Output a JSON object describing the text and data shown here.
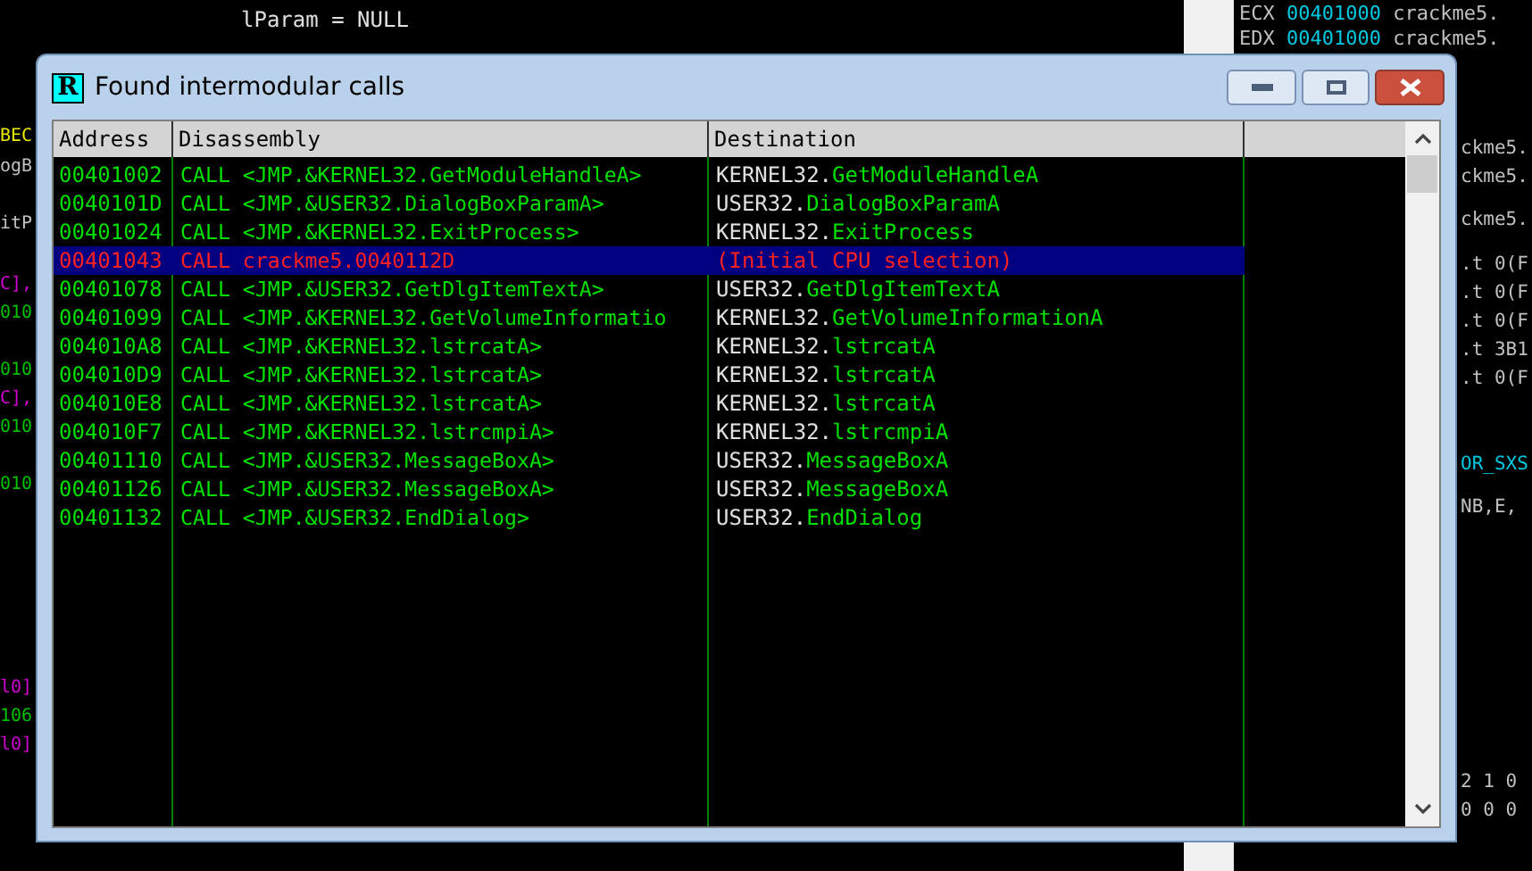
{
  "background": {
    "top_text": "lParam = NULL",
    "left_fragments": [
      {
        "text": "BEC",
        "color": "#e8e800"
      },
      {
        "text": "ogB",
        "color": "#c0c0c0"
      },
      {
        "text": "itP",
        "color": "#c0c0c0"
      },
      {
        "text": "C],",
        "color": "#d000d0"
      },
      {
        "text": "010",
        "color": "#00c000"
      },
      {
        "text": "010",
        "color": "#00c000"
      },
      {
        "text": "C],",
        "color": "#d000d0"
      },
      {
        "text": "010",
        "color": "#00c000"
      },
      {
        "text": "010",
        "color": "#00c000"
      },
      {
        "text": "l0]",
        "color": "#d000d0"
      },
      {
        "text": "106",
        "color": "#00c000"
      },
      {
        "text": "l0]",
        "color": "#d000d0"
      }
    ],
    "registers": [
      {
        "name": "ECX",
        "value": "00401000",
        "comment": "crackme5."
      },
      {
        "name": "EDX",
        "value": "00401000",
        "comment": "crackme5."
      }
    ],
    "right_fragments": [
      {
        "text": "ckme5.",
        "color": "#c0c0c0"
      },
      {
        "text": "ckme5.",
        "color": "#c0c0c0"
      },
      {
        "text": "ckme5.",
        "color": "#c0c0c0"
      },
      {
        "text": ".t 0(F",
        "color": "#c0c0c0"
      },
      {
        "text": ".t 0(F",
        "color": "#c0c0c0"
      },
      {
        "text": ".t 0(F",
        "color": "#c0c0c0"
      },
      {
        "text": ".t 3B1",
        "color": "#c0c0c0"
      },
      {
        "text": ".t 0(F",
        "color": "#c0c0c0"
      },
      {
        "text": "OR_SXS",
        "color": "#00c8e0"
      },
      {
        "text": "NB,E,",
        "color": "#c0c0c0"
      },
      {
        "text": "2 1 0",
        "color": "#c0c0c0"
      },
      {
        "text": "0 0 0",
        "color": "#c0c0c0"
      }
    ]
  },
  "window": {
    "icon_letter": "R",
    "title": "Found intermodular calls"
  },
  "table": {
    "columns": [
      "Address",
      "Disassembly",
      "Destination"
    ],
    "rows": [
      {
        "address": "00401002",
        "disassembly": "CALL <JMP.&KERNEL32.GetModuleHandleA>",
        "destination": {
          "module": "KERNEL32.",
          "function": "GetModuleHandleA"
        },
        "selected": false
      },
      {
        "address": "0040101D",
        "disassembly": "CALL <JMP.&USER32.DialogBoxParamA>",
        "destination": {
          "module": "USER32.",
          "function": "DialogBoxParamA"
        },
        "selected": false
      },
      {
        "address": "00401024",
        "disassembly": "CALL <JMP.&KERNEL32.ExitProcess>",
        "destination": {
          "module": "KERNEL32.",
          "function": "ExitProcess"
        },
        "selected": false
      },
      {
        "address": "00401043",
        "disassembly": "CALL crackme5.0040112D",
        "destination": {
          "function": "(Initial CPU selection)"
        },
        "selected": true
      },
      {
        "address": "00401078",
        "disassembly": "CALL <JMP.&USER32.GetDlgItemTextA>",
        "destination": {
          "module": "USER32.",
          "function": "GetDlgItemTextA"
        },
        "selected": false
      },
      {
        "address": "00401099",
        "disassembly": "CALL <JMP.&KERNEL32.GetVolumeInformatio",
        "destination": {
          "module": "KERNEL32.",
          "function": "GetVolumeInformationA"
        },
        "selected": false
      },
      {
        "address": "004010A8",
        "disassembly": "CALL <JMP.&KERNEL32.lstrcatA>",
        "destination": {
          "module": "KERNEL32.",
          "function": "lstrcatA"
        },
        "selected": false
      },
      {
        "address": "004010D9",
        "disassembly": "CALL <JMP.&KERNEL32.lstrcatA>",
        "destination": {
          "module": "KERNEL32.",
          "function": "lstrcatA"
        },
        "selected": false
      },
      {
        "address": "004010E8",
        "disassembly": "CALL <JMP.&KERNEL32.lstrcatA>",
        "destination": {
          "module": "KERNEL32.",
          "function": "lstrcatA"
        },
        "selected": false
      },
      {
        "address": "004010F7",
        "disassembly": "CALL <JMP.&KERNEL32.lstrcmpiA>",
        "destination": {
          "module": "KERNEL32.",
          "function": "lstrcmpiA"
        },
        "selected": false
      },
      {
        "address": "00401110",
        "disassembly": "CALL <JMP.&USER32.MessageBoxA>",
        "destination": {
          "module": "USER32.",
          "function": "MessageBoxA"
        },
        "selected": false
      },
      {
        "address": "00401126",
        "disassembly": "CALL <JMP.&USER32.MessageBoxA>",
        "destination": {
          "module": "USER32.",
          "function": "MessageBoxA"
        },
        "selected": false
      },
      {
        "address": "00401132",
        "disassembly": "CALL <JMP.&USER32.EndDialog>",
        "destination": {
          "module": "USER32.",
          "function": "EndDialog"
        },
        "selected": false
      }
    ]
  }
}
